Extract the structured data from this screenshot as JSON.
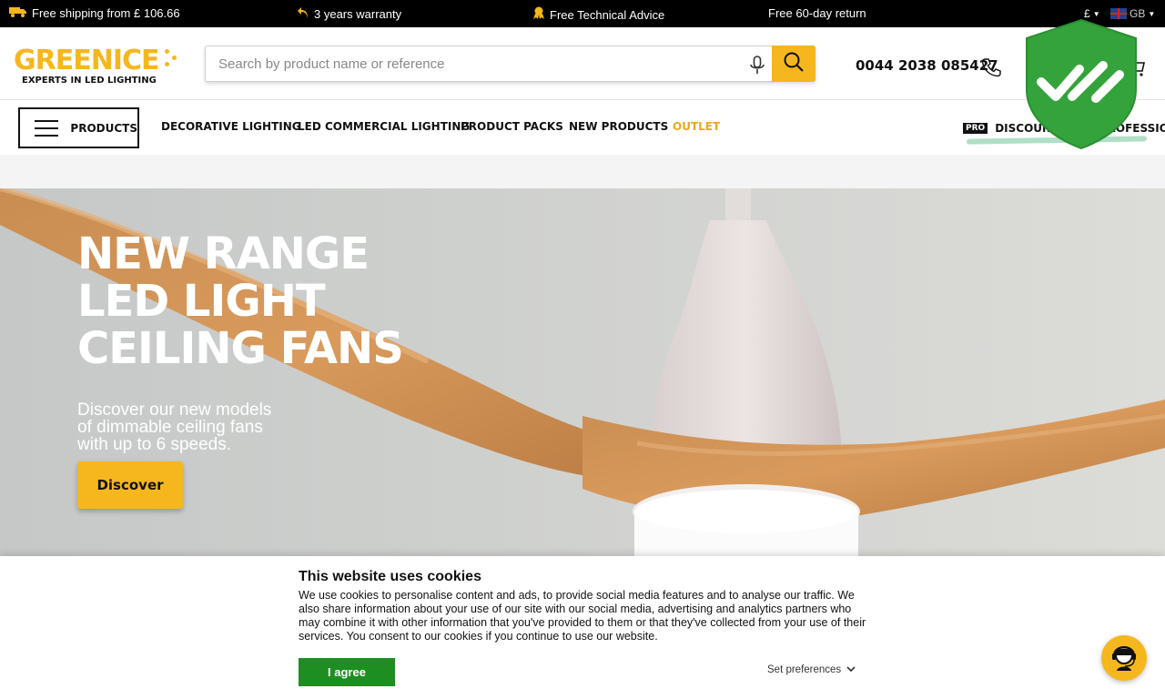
{
  "topbar": {
    "shipping": "Free shipping from £ 106.66",
    "warranty": "3 years warranty",
    "advice": "Free Technical Advice",
    "return": "Free 60-day return",
    "currency": "£",
    "country": "GB",
    "icons": [
      "truck-icon",
      "return-arrow-icon",
      "award-icon"
    ]
  },
  "header": {
    "logo_word": "GREENICE",
    "logo_tagline": "EXPERTS IN LED LIGHTING",
    "search_placeholder": "Search by product name or reference",
    "phone": "0044 2038 085427"
  },
  "nav": {
    "products": "PRODUCTS",
    "links": [
      "DECORATIVE LIGHTING",
      "LED COMMERCIAL LIGHTING",
      "PRODUCT PACKS",
      "NEW PRODUCTS",
      "OUTLET"
    ],
    "pro_badge": "PRO",
    "pro_text": "DISCOUNTS FOR PROFESSIONALS"
  },
  "hero": {
    "title_lines": [
      "NEW RANGE",
      "LED LIGHT",
      "CEILING FANS"
    ],
    "subtitle_lines": [
      "Discover our new models",
      "of dimmable ceiling fans",
      "with up to 6 speeds."
    ],
    "button": "Discover"
  },
  "cookie": {
    "title": "This website uses cookies",
    "text": "We use cookies to personalise content and ads, to provide social media features and to analyse our traffic. We also share information about your use of our site with our social media, advertising and analytics partners who may combine it with other information that you've provided to them or that they've collected from your use of their services. You consent to our cookies if you continue to use our website.",
    "agree": "I agree",
    "preferences": "Set preferences"
  },
  "colors": {
    "brand_yellow": "#f5b71d",
    "agree_green": "#1e8e23",
    "shield_green": "#35a33b",
    "topbar_black": "#000000"
  }
}
